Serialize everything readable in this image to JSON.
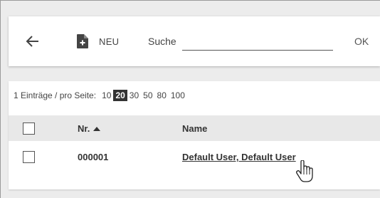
{
  "toolbar": {
    "back_icon": "arrow-left-icon",
    "new_icon": "document-plus-icon",
    "new_label": "NEU",
    "search_label": "Suche",
    "search_value": "",
    "search_placeholder": "",
    "ok_label": "OK"
  },
  "pager": {
    "count_label": "1 Einträge / pro Seite:",
    "options": [
      "10",
      "20",
      "30",
      "50",
      "80",
      "100"
    ],
    "selected": "20"
  },
  "table": {
    "columns": [
      {
        "label": "",
        "type": "checkbox"
      },
      {
        "label": "Nr.",
        "sort": "ascending"
      },
      {
        "label": "Name"
      }
    ],
    "rows": [
      {
        "nr": "000001",
        "name": "Default User, Default User"
      }
    ]
  },
  "colors": {
    "background": "#ececec",
    "panel": "#ffffff",
    "header_row": "#e8e8e8",
    "active_page": "#333333"
  }
}
